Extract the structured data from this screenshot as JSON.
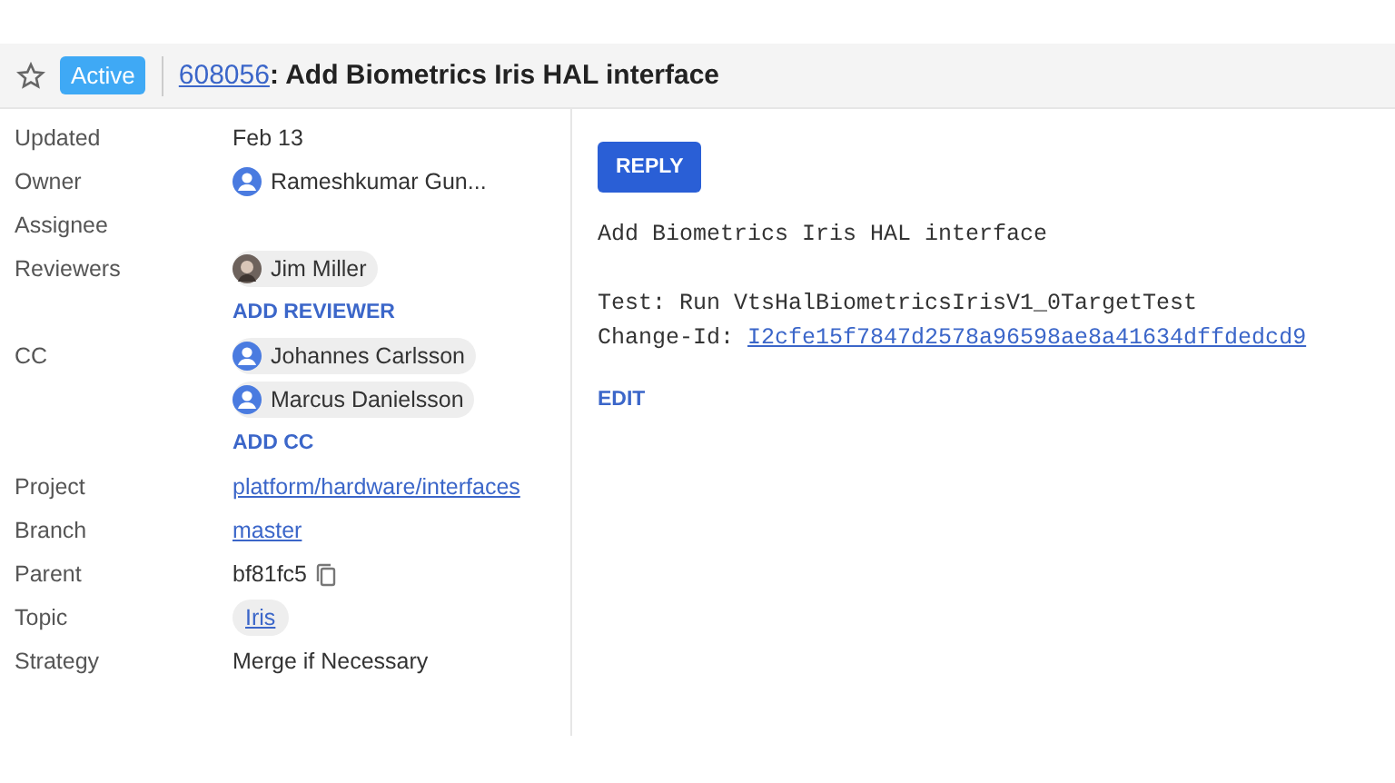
{
  "header": {
    "starred": false,
    "status": "Active",
    "change_number": "608056",
    "title": ": Add Biometrics Iris HAL interface"
  },
  "metadata": [
    {
      "label": "Updated",
      "kind": "text",
      "value": "Feb 13"
    },
    {
      "label": "Owner",
      "kind": "owner",
      "people": [
        {
          "name": "Rameshkumar Gun...",
          "kind": "generic"
        }
      ]
    },
    {
      "label": "Assignee",
      "kind": "empty"
    },
    {
      "label": "Reviewers",
      "kind": "people",
      "people": [
        {
          "name": "Jim Miller",
          "kind": "photo"
        }
      ],
      "action": "ADD REVIEWER"
    },
    {
      "label": "CC",
      "kind": "people",
      "people": [
        {
          "name": "Johannes Carlsson",
          "kind": "generic"
        },
        {
          "name": "Marcus Danielsson",
          "kind": "generic"
        }
      ],
      "action": "ADD CC"
    },
    {
      "label": "Project",
      "kind": "link",
      "value": "platform/hardware/interfaces"
    },
    {
      "label": "Branch",
      "kind": "link",
      "value": "master"
    },
    {
      "label": "Parent",
      "kind": "copy",
      "value": "bf81fc5"
    },
    {
      "label": "Topic",
      "kind": "topic",
      "value": "Iris"
    },
    {
      "label": "Strategy",
      "kind": "text",
      "value": "Merge if Necessary"
    }
  ],
  "reply_button": "REPLY",
  "message": [
    {
      "kind": "text",
      "text": "Add Biometrics Iris HAL interface"
    },
    {
      "kind": "blank"
    },
    {
      "kind": "text",
      "text": "Test: Run VtsHalBiometricsIrisV1_0TargetTest"
    },
    {
      "kind": "change_id",
      "label": "Change-Id: ",
      "id": "I2cfe15f7847d2578a96598ae8a41634dffdedcd9"
    }
  ],
  "edit_link": "EDIT"
}
